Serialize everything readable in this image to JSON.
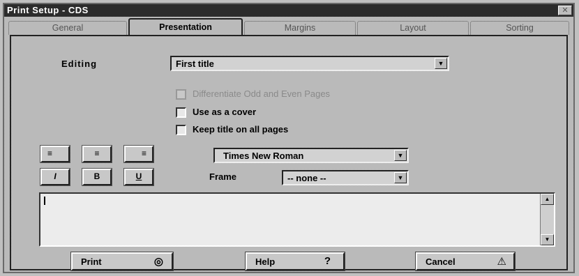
{
  "window": {
    "title": "Print Setup - CDS",
    "close_icon": "close-icon"
  },
  "tabs": [
    {
      "label": "General"
    },
    {
      "label": "Presentation"
    },
    {
      "label": "Margins"
    },
    {
      "label": "Layout"
    },
    {
      "label": "Sorting"
    }
  ],
  "active_tab": "Presentation",
  "editing": {
    "label": "Editing",
    "value": "First title"
  },
  "checkboxes": [
    {
      "label": "Differentiate Odd and Even Pages",
      "checked": false,
      "enabled": false
    },
    {
      "label": "Use as a cover",
      "checked": false,
      "enabled": true
    },
    {
      "label": "Keep title on all pages",
      "checked": false,
      "enabled": true
    }
  ],
  "align_buttons": [
    {
      "icon": "align-left-icon",
      "glyph": "≡"
    },
    {
      "icon": "align-center-icon",
      "glyph": "≡"
    },
    {
      "icon": "align-right-icon",
      "glyph": "≡"
    }
  ],
  "style_buttons": [
    {
      "icon": "italic-icon",
      "glyph": "I"
    },
    {
      "icon": "bold-icon",
      "glyph": "B"
    },
    {
      "icon": "underline-icon",
      "glyph": "U"
    }
  ],
  "font": {
    "value": "Times New Roman"
  },
  "frame": {
    "label": "Frame",
    "value": "-- none --"
  },
  "text_area": {
    "value": ""
  },
  "buttons": {
    "print": {
      "label": "Print",
      "icon": "print-icon"
    },
    "help": {
      "label": "Help",
      "icon": "question-icon",
      "glyph": "?"
    },
    "cancel": {
      "label": "Cancel",
      "icon": "warning-icon",
      "glyph": "⚠"
    }
  }
}
